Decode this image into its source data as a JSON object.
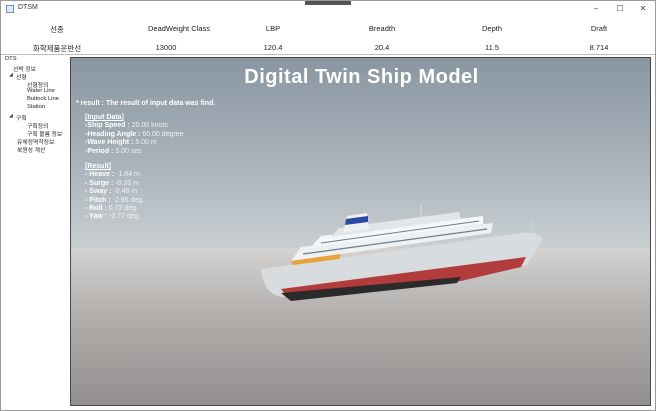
{
  "window": {
    "title": "DTSM",
    "minimize_glyph": "–",
    "maximize_glyph": "☐",
    "close_glyph": "✕"
  },
  "header": {
    "columns": [
      "선종",
      "DeadWeight Class",
      "LBP",
      "Breadth",
      "Depth",
      "Draft"
    ],
    "values": [
      "화학제품운반선",
      "13000",
      "120.4",
      "20.4",
      "11.5",
      "8.714"
    ]
  },
  "tree": {
    "root": "DTS",
    "items": {
      "ship_info": "선박 정보",
      "hull_form": "선형",
      "hull_def": "선형정의",
      "water_line": "Water Line",
      "buttock_line": "Buttock Line",
      "station": "Station",
      "compartment": "구획",
      "compartment_def": "구획정의",
      "compartment_volume": "구획 볼륨 정보",
      "hydrostatics": "유체정역학정보",
      "stability": "복원성 계산"
    },
    "expand_glyph": "◢"
  },
  "scene": {
    "title": "Digital Twin Ship Model",
    "result_line": "* result : The result of input data was find.",
    "input_header": "[Input Data]",
    "inputs": [
      {
        "label": "-Ship Speed :",
        "value": "20.00 knots"
      },
      {
        "label": "-Heading Angle :",
        "value": "60.00 degree"
      },
      {
        "label": "-Wave Height :",
        "value": "5.00 m"
      },
      {
        "label": "-Period :",
        "value": "5.00 sec"
      }
    ],
    "result_header": "[Result]",
    "results": [
      {
        "label": "- Heave :",
        "value": "-1.84 m"
      },
      {
        "label": "- Surge :",
        "value": "-0.20 m"
      },
      {
        "label": "- Sway :",
        "value": "-0.48 m"
      },
      {
        "label": "- Pitch :",
        "value": "-2.95 deg."
      },
      {
        "label": "- Roll :",
        "value": "0.72 deg."
      },
      {
        "label": "- Yaw :",
        "value": "-0.77 deg."
      }
    ]
  },
  "colors": {
    "hull_red": "#b23b3b",
    "superstructure": "#eef0f2",
    "funnel_blue": "#2a4aa6"
  }
}
